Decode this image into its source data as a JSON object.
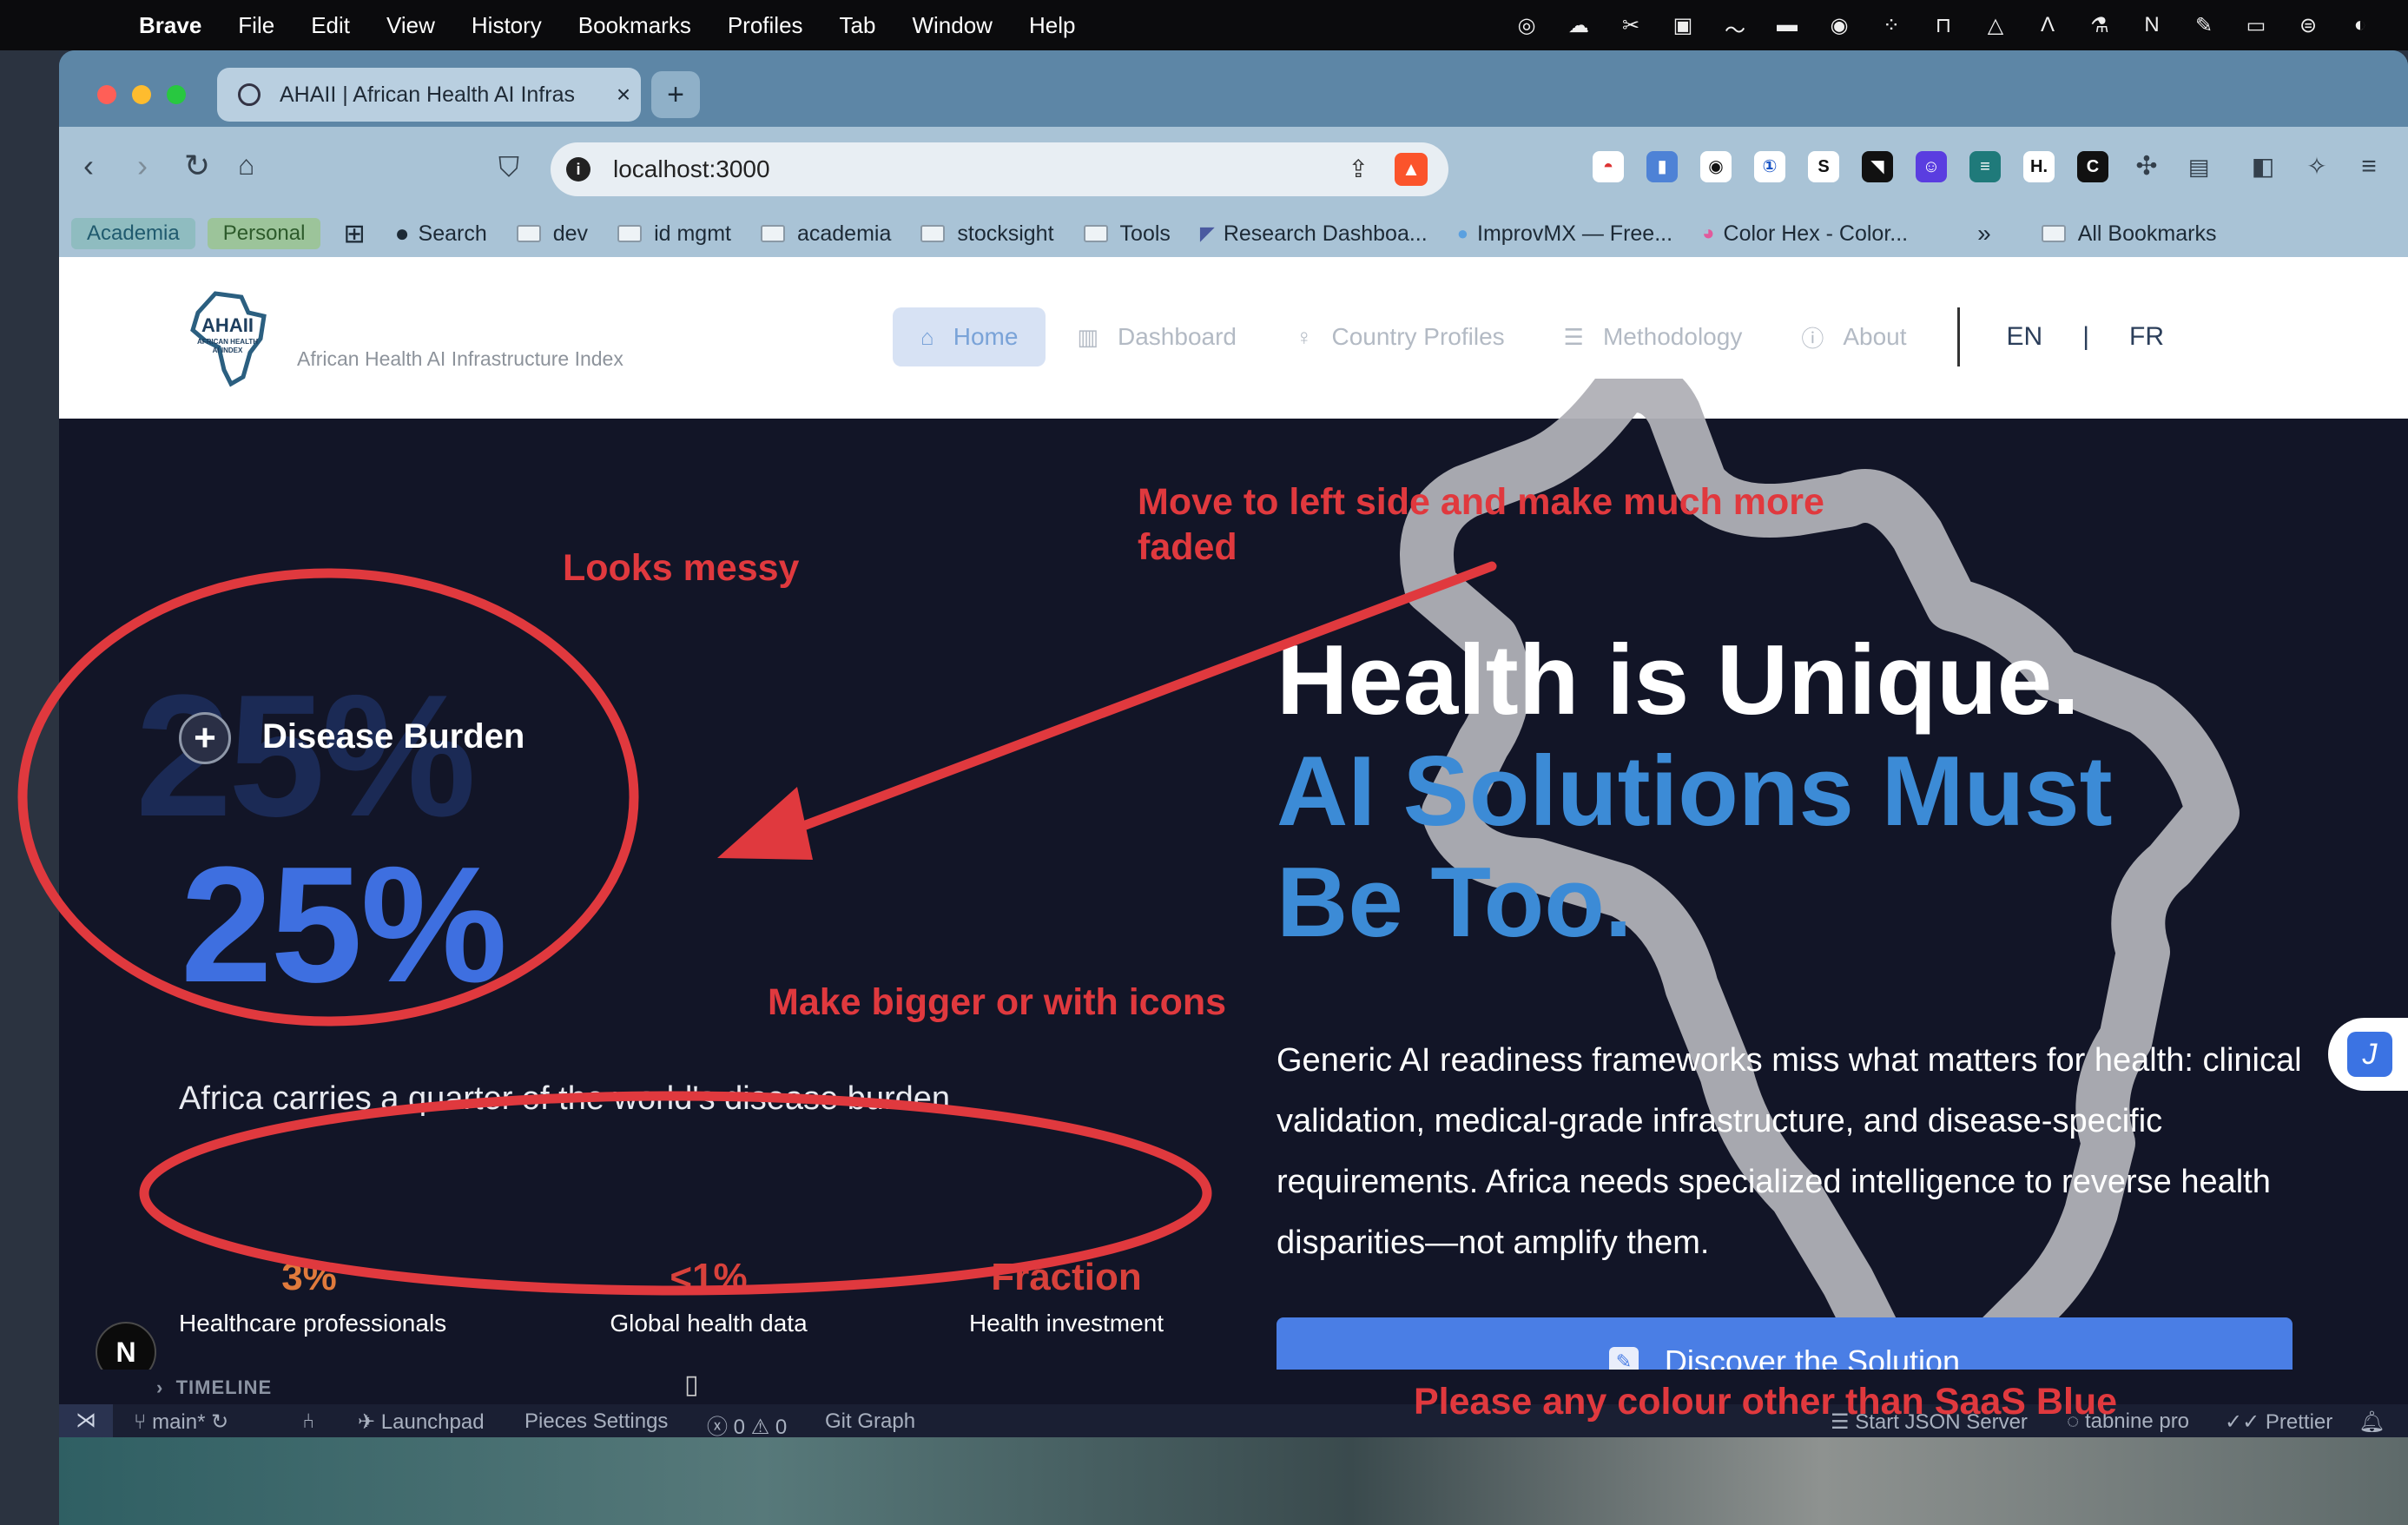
{
  "menubar": {
    "app": "Brave",
    "items": [
      "File",
      "Edit",
      "View",
      "History",
      "Bookmarks",
      "Profiles",
      "Tab",
      "Window",
      "Help"
    ]
  },
  "browser": {
    "tab_title": "AHAII | African Health AI Infras",
    "url": "localhost:3000",
    "bookmarks": {
      "profile_chips": [
        "Academia",
        "Personal"
      ],
      "items": [
        "Search",
        "dev",
        "id mgmt",
        "academia",
        "stocksight",
        "Tools",
        "Research Dashboa...",
        "ImprovMX — Free...",
        "Color Hex - Color..."
      ],
      "overflow": "»",
      "all": "All Bookmarks"
    }
  },
  "site": {
    "logo_tagline": "African Health AI Infrastructure Index",
    "nav": {
      "items": [
        "Home",
        "Dashboard",
        "Country Profiles",
        "Methodology",
        "About"
      ],
      "langs": [
        "EN",
        "FR"
      ]
    },
    "stat": {
      "watermark": "25%",
      "label": "Disease Burden",
      "value": "25%",
      "description": "Africa carries a quarter of the world's disease burden",
      "mini": [
        {
          "value": "3%",
          "label": "Healthcare professionals"
        },
        {
          "value": "<1%",
          "label": "Global health data"
        },
        {
          "value": "Fraction",
          "label": "Health investment"
        }
      ]
    },
    "hero": {
      "headline_line1": "Health is Unique.",
      "headline_line2": "AI Solutions Must",
      "headline_line3": "Be Too.",
      "description": "Generic AI readiness frameworks miss what matters for health: clinical validation, medical-grade infrastructure, and disease-specific requirements. Africa needs specialized intelligence to reverse health disparities—not amplify them.",
      "cta": "Discover the Solution"
    },
    "floating_badge": "N"
  },
  "vscode": {
    "timeline": "TIMELINE",
    "status": {
      "branch": "main*",
      "launchpad": "Launchpad",
      "pieces": "Pieces Settings",
      "problems": "0",
      "warnings": "0",
      "git_graph": "Git Graph",
      "json_server": "Start JSON Server",
      "tabnine": "tabnine pro",
      "prettier": "Prettier"
    }
  },
  "annotations": {
    "move_left": "Move to left side and make much more faded",
    "move_left_line1": "Move to left side and make much more",
    "move_left_line2": "faded",
    "looks_messy": "Looks messy",
    "make_bigger": "Make bigger or with icons",
    "colour": "Please any colour other than SaaS Blue",
    "color": "#e0393e"
  },
  "colors": {
    "page_bg": "#121527",
    "accent_blue": "#3e6fe0",
    "headline_blue": "#3c8bd6",
    "orange": "#e07a3c"
  }
}
